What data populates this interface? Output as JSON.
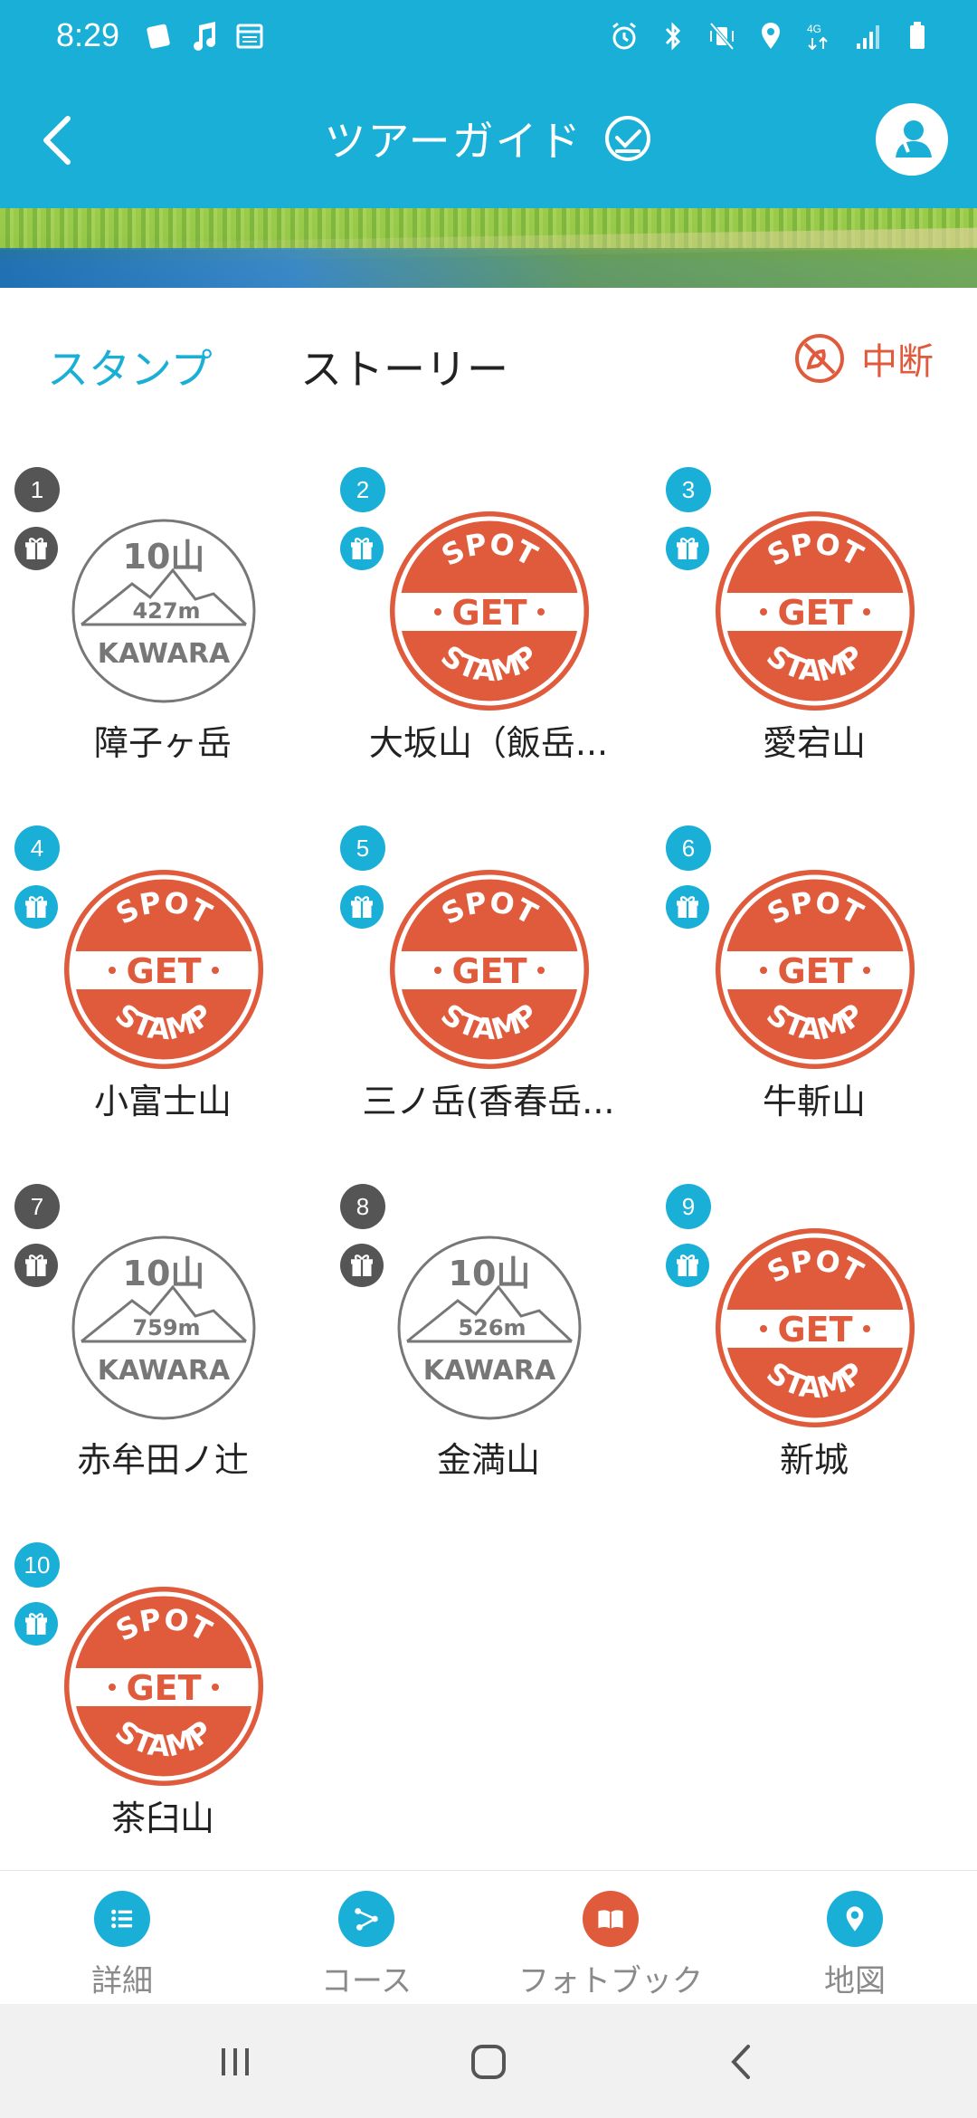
{
  "status_bar": {
    "time": "8:29"
  },
  "header": {
    "title": "ツアーガイド"
  },
  "tabs": {
    "stamp_label": "スタンプ",
    "story_label": "ストーリー",
    "active": "スタンプ",
    "suspend_label": "中断"
  },
  "stamp_text": {
    "spot": "SPOT",
    "get": "GET",
    "stamp": "STAMP",
    "ten_mountains": "10山",
    "kawara": "KAWARA"
  },
  "stamps": [
    {
      "number": "1",
      "name": "障子ヶ岳",
      "collected": false,
      "elevation": "427m"
    },
    {
      "number": "2",
      "name": "大坂山（飯岳...",
      "collected": true
    },
    {
      "number": "3",
      "name": "愛宕山",
      "collected": true
    },
    {
      "number": "4",
      "name": "小富士山",
      "collected": true
    },
    {
      "number": "5",
      "name": "三ノ岳(香春岳...",
      "collected": true
    },
    {
      "number": "6",
      "name": "牛斬山",
      "collected": true
    },
    {
      "number": "7",
      "name": "赤牟田ノ辻",
      "collected": false,
      "elevation": "759m"
    },
    {
      "number": "8",
      "name": "金満山",
      "collected": false,
      "elevation": "526m"
    },
    {
      "number": "9",
      "name": "新城",
      "collected": true
    },
    {
      "number": "10",
      "name": "茶臼山",
      "collected": true
    }
  ],
  "bottom_nav": [
    {
      "label": "詳細",
      "icon": "list-icon",
      "color": "#1aafd6"
    },
    {
      "label": "コース",
      "icon": "route-icon",
      "color": "#1aafd6"
    },
    {
      "label": "フォトブック",
      "icon": "book-icon",
      "color": "#e05a3c"
    },
    {
      "label": "地図",
      "icon": "map-pin-icon",
      "color": "#1aafd6"
    }
  ],
  "colors": {
    "primary": "#1aafd6",
    "stamp_red": "#e05a3c",
    "uncollected_gray": "#555555"
  }
}
